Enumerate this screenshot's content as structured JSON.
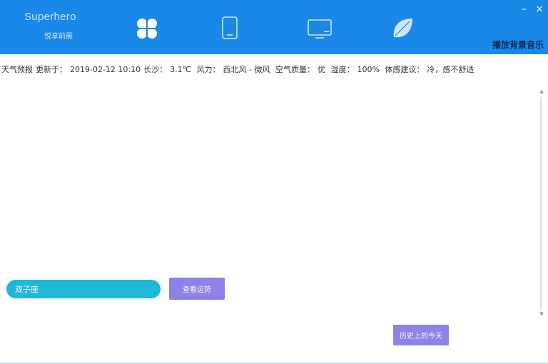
{
  "app": {
    "title": "Superhero",
    "subtitle": "悦享前晨"
  },
  "nav": {
    "items": [
      {
        "icon": "clover-icon",
        "active": true
      },
      {
        "icon": "tablet-icon",
        "active": false
      },
      {
        "icon": "monitor-icon",
        "active": false
      },
      {
        "icon": "leaf-icon",
        "active": false
      }
    ]
  },
  "window_controls": {
    "minimize": "–",
    "close": "×"
  },
  "music": {
    "label": "播放背景音乐"
  },
  "weather": {
    "label": "天气预报",
    "updated": "更新于：",
    "datetime": "2019-02-12 10:10",
    "temp_label": "长沙：",
    "temp": "3.1℃",
    "wind_label": "风力：",
    "wind": "西北风 - 微风",
    "air_label": "空气质量：",
    "air": "优",
    "humidity_label": "湿度：",
    "humidity": "100%",
    "advice_label": "体感建议：",
    "advice": "冷，感不舒适"
  },
  "search": {
    "value": "双子座"
  },
  "buttons": {
    "query": "查看运势",
    "history": "历史上的今天"
  },
  "colors": {
    "header_bg": "#1a88e8",
    "input_bg": "#1fb8d6",
    "button_bg": "#8c82e8"
  }
}
